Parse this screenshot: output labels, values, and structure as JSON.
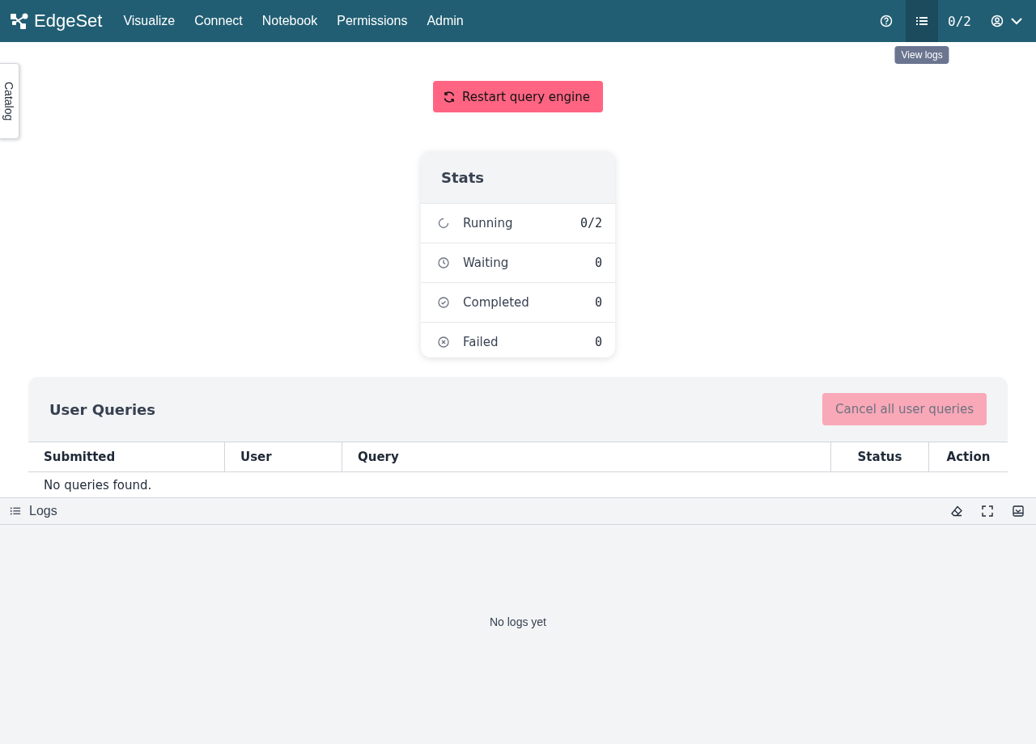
{
  "header": {
    "brand": "EdgeSet",
    "nav": [
      {
        "label": "Visualize",
        "selected": false
      },
      {
        "label": "Connect",
        "selected": false
      },
      {
        "label": "Notebook",
        "selected": false
      },
      {
        "label": "Permissions",
        "selected": false
      },
      {
        "label": "Admin",
        "selected": false
      }
    ],
    "logs_button": {
      "active": true,
      "tooltip": "View logs"
    },
    "query_count": "0/2"
  },
  "catalog_tab": "Catalog",
  "restart_button": "Restart query engine",
  "stats": {
    "title": "Stats",
    "rows": [
      {
        "kind": "running",
        "label": "Running",
        "value": "0/2"
      },
      {
        "kind": "waiting",
        "label": "Waiting",
        "value": "0"
      },
      {
        "kind": "completed",
        "label": "Completed",
        "value": "0"
      },
      {
        "kind": "failed",
        "label": "Failed",
        "value": "0"
      }
    ]
  },
  "user_queries": {
    "title": "User Queries",
    "cancel_button": {
      "label": "Cancel all user queries",
      "disabled": true
    },
    "columns": [
      "Submitted",
      "User",
      "Query",
      "Status",
      "Action"
    ],
    "empty_text": "No queries found."
  },
  "logs": {
    "title": "Logs",
    "empty_text": "No logs yet"
  }
}
